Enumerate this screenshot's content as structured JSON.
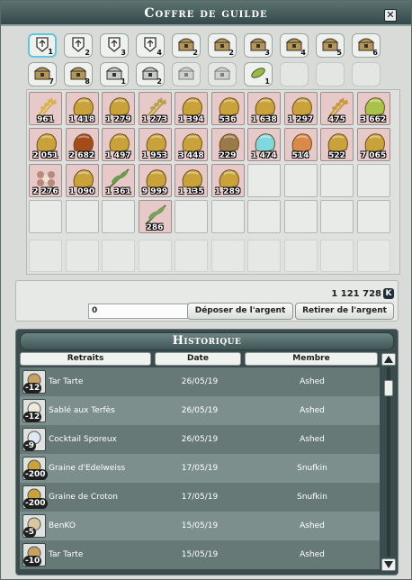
{
  "window": {
    "title": "Coffre de guilde",
    "close_label": "✕"
  },
  "tabs": [
    {
      "num": "1",
      "state": "active",
      "icon": "guild-scroll-icon"
    },
    {
      "num": "2",
      "state": "normal",
      "icon": "guild-scroll-icon"
    },
    {
      "num": "3",
      "state": "normal",
      "icon": "guild-scroll-icon"
    },
    {
      "num": "4",
      "state": "normal",
      "icon": "guild-scroll-icon"
    },
    {
      "num": "2",
      "state": "normal",
      "icon": "chest-icon"
    },
    {
      "num": "2",
      "state": "normal",
      "icon": "chest-icon"
    },
    {
      "num": "3",
      "state": "normal",
      "icon": "chest-icon"
    },
    {
      "num": "4",
      "state": "normal",
      "icon": "chest-icon"
    },
    {
      "num": "5",
      "state": "normal",
      "icon": "chest-icon"
    },
    {
      "num": "6",
      "state": "normal",
      "icon": "chest-icon"
    },
    {
      "num": "7",
      "state": "normal",
      "icon": "chest-icon"
    },
    {
      "num": "8",
      "state": "normal",
      "icon": "chest-icon"
    },
    {
      "num": "1",
      "state": "normal",
      "icon": "locked-chest-icon"
    },
    {
      "num": "2",
      "state": "normal",
      "icon": "locked-chest-icon"
    },
    {
      "num": "",
      "state": "dim",
      "icon": "locked-chest-icon"
    },
    {
      "num": "",
      "state": "dim",
      "icon": "locked-chest-icon"
    },
    {
      "num": "1",
      "state": "normal",
      "icon": "leaf-icon"
    },
    {
      "num": "",
      "state": "empty",
      "icon": ""
    },
    {
      "num": "",
      "state": "empty",
      "icon": ""
    },
    {
      "num": "",
      "state": "empty",
      "icon": ""
    }
  ],
  "inventory": [
    {
      "qty": "961",
      "icon": "wheat-icon",
      "color": "#d9b24a"
    },
    {
      "qty": "1 418",
      "icon": "seed-bag-icon",
      "color": "#c9a23a"
    },
    {
      "qty": "1 279",
      "icon": "seed-bag-icon",
      "color": "#c9a23a"
    },
    {
      "qty": "1 273",
      "icon": "wheat-icon",
      "color": "#b8a04a"
    },
    {
      "qty": "1 394",
      "icon": "seed-bag-icon",
      "color": "#c9a23a"
    },
    {
      "qty": "536",
      "icon": "seed-bag-icon",
      "color": "#c9a23a"
    },
    {
      "qty": "1 638",
      "icon": "seed-bag-icon",
      "color": "#c9a23a"
    },
    {
      "qty": "1 297",
      "icon": "seed-bag-icon",
      "color": "#c9a23a"
    },
    {
      "qty": "475",
      "icon": "wheat-icon",
      "color": "#c89a3a"
    },
    {
      "qty": "3 662",
      "icon": "seed-bag-icon",
      "color": "#a8c24a"
    },
    {
      "qty": "2 051",
      "icon": "seed-bag-icon",
      "color": "#c9a23a"
    },
    {
      "qty": "2 682",
      "icon": "seed-bag-icon",
      "color": "#a54a1a"
    },
    {
      "qty": "1 497",
      "icon": "seed-bag-icon",
      "color": "#c9a23a"
    },
    {
      "qty": "1 953",
      "icon": "seed-bag-icon",
      "color": "#c9a23a"
    },
    {
      "qty": "3 448",
      "icon": "seed-bag-icon",
      "color": "#c9a23a"
    },
    {
      "qty": "229",
      "icon": "seed-bag-icon",
      "color": "#9b7a4a"
    },
    {
      "qty": "1 474",
      "icon": "seed-bag-icon",
      "color": "#7fd8e0"
    },
    {
      "qty": "514",
      "icon": "seed-bag-icon",
      "color": "#d98a4a"
    },
    {
      "qty": "522",
      "icon": "seed-bag-icon",
      "color": "#c9a23a"
    },
    {
      "qty": "7 065",
      "icon": "seed-bag-icon",
      "color": "#c9a23a"
    },
    {
      "qty": "2 276",
      "icon": "flower-icon",
      "color": "#b88a7a"
    },
    {
      "qty": "1 090",
      "icon": "seed-bag-icon",
      "color": "#c9a23a"
    },
    {
      "qty": "1 361",
      "icon": "plant-icon",
      "color": "#6a9a4a"
    },
    {
      "qty": "9 999",
      "icon": "seed-bag-icon",
      "color": "#c9a23a"
    },
    {
      "qty": "1 135",
      "icon": "seed-bag-icon",
      "color": "#c9a23a"
    },
    {
      "qty": "1 289",
      "icon": "seed-bag-icon",
      "color": "#c9a23a"
    },
    {
      "qty": "",
      "icon": "",
      "color": ""
    },
    {
      "qty": "",
      "icon": "",
      "color": ""
    },
    {
      "qty": "",
      "icon": "",
      "color": ""
    },
    {
      "qty": "",
      "icon": "",
      "color": ""
    },
    {
      "qty": "",
      "icon": "",
      "color": ""
    },
    {
      "qty": "",
      "icon": "",
      "color": ""
    },
    {
      "qty": "",
      "icon": "",
      "color": ""
    },
    {
      "qty": "286",
      "icon": "plant-icon",
      "color": "#7aa05a"
    },
    {
      "qty": "",
      "icon": "",
      "color": ""
    },
    {
      "qty": "",
      "icon": "",
      "color": ""
    },
    {
      "qty": "",
      "icon": "",
      "color": ""
    },
    {
      "qty": "",
      "icon": "",
      "color": ""
    },
    {
      "qty": "",
      "icon": "",
      "color": ""
    },
    {
      "qty": "",
      "icon": "",
      "color": ""
    }
  ],
  "money": {
    "total": "1 121 728",
    "currency_icon": "kamas-icon",
    "input_value": "0",
    "deposit_label": "Déposer de l'argent",
    "withdraw_label": "Retirer de l'argent"
  },
  "history": {
    "title": "Historique",
    "columns": {
      "withdrawals": "Retraits",
      "date": "Date",
      "member": "Membre"
    },
    "rows": [
      {
        "qty": "-12",
        "item": "Tar Tarte",
        "date": "26/05/19",
        "member": "Ashed",
        "icon": "tart-icon"
      },
      {
        "qty": "-12",
        "item": "Sablé aux Terfès",
        "date": "26/05/19",
        "member": "Ashed",
        "icon": "cookie-icon"
      },
      {
        "qty": "-9",
        "item": "Cocktail Sporeux",
        "date": "26/05/19",
        "member": "Ashed",
        "icon": "cocktail-icon"
      },
      {
        "qty": "-200",
        "item": "Graine d'Edelweiss",
        "date": "17/05/19",
        "member": "Snufkin",
        "icon": "seed-bag-icon"
      },
      {
        "qty": "-200",
        "item": "Graine de Croton",
        "date": "17/05/19",
        "member": "Snufkin",
        "icon": "seed-bag-icon"
      },
      {
        "qty": "-5",
        "item": "BenKO",
        "date": "15/05/19",
        "member": "Ashed",
        "icon": "bowl-icon"
      },
      {
        "qty": "-10",
        "item": "Tar Tarte",
        "date": "15/05/19",
        "member": "Ashed",
        "icon": "tart-icon"
      }
    ]
  }
}
